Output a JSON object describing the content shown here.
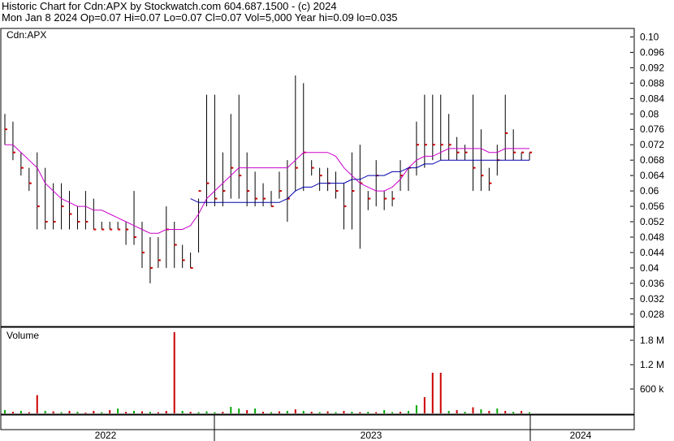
{
  "header": {
    "line1": "Historic Chart for Cdn:APX by Stockwatch.com 604.687.1500 - (c) 2024",
    "line2": "Mon Jan  8 2024  Op=0.07  Hi=0.07  Lo=0.07  Cl=0.07  Vol=5,000  Year hi=0.09  lo=0.035"
  },
  "chart_data": [
    {
      "type": "line",
      "title": "Cdn:APX",
      "symbol": "Cdn:APX",
      "ylim": [
        0.025,
        0.102
      ],
      "y_ticks": [
        "0.10",
        "0.096",
        "0.092",
        "0.088",
        "0.084",
        "0.08",
        "0.076",
        "0.072",
        "0.068",
        "0.064",
        "0.06",
        "0.056",
        "0.052",
        "0.048",
        "0.044",
        "0.04",
        "0.036",
        "0.032",
        "0.028"
      ],
      "grid": false,
      "colors": {
        "price_bar": "#000000",
        "close_dot": "#cc0000",
        "ma_short": "#cc00cc",
        "ma_long": "#0000aa"
      },
      "x": [
        0,
        10,
        20,
        30,
        40,
        50,
        60,
        70,
        80,
        90,
        100,
        110,
        120,
        130,
        140,
        150,
        160,
        170,
        180,
        190,
        200,
        210,
        220,
        230,
        240,
        250,
        260,
        270,
        280,
        290,
        300,
        310,
        320,
        330,
        340,
        350,
        360,
        370,
        380,
        390,
        400,
        410,
        420,
        430,
        440,
        450,
        460,
        470,
        480,
        490,
        500,
        510,
        520,
        530,
        540,
        550,
        560,
        570,
        580,
        590,
        600,
        610,
        620,
        630,
        640,
        650
      ],
      "high": [
        0.08,
        0.078,
        0.07,
        0.066,
        0.07,
        0.066,
        0.062,
        0.062,
        0.06,
        0.056,
        0.06,
        0.058,
        0.052,
        0.052,
        0.052,
        0.052,
        0.06,
        0.052,
        0.048,
        0.048,
        0.056,
        0.052,
        0.046,
        0.044,
        0.044,
        0.085,
        0.085,
        0.07,
        0.08,
        0.085,
        0.07,
        0.065,
        0.062,
        0.06,
        0.065,
        0.068,
        0.09,
        0.088,
        0.068,
        0.066,
        0.066,
        0.065,
        0.062,
        0.07,
        0.072,
        0.06,
        0.068,
        0.06,
        0.06,
        0.068,
        0.066,
        0.078,
        0.085,
        0.085,
        0.085,
        0.08,
        0.074,
        0.072,
        0.085,
        0.076,
        0.066,
        0.072,
        0.085,
        0.076,
        0.07,
        0.07
      ],
      "low": [
        0.072,
        0.068,
        0.064,
        0.06,
        0.05,
        0.05,
        0.05,
        0.05,
        0.05,
        0.05,
        0.05,
        0.05,
        0.05,
        0.05,
        0.05,
        0.046,
        0.046,
        0.04,
        0.036,
        0.04,
        0.04,
        0.04,
        0.04,
        0.04,
        0.058,
        0.056,
        0.056,
        0.056,
        0.058,
        0.058,
        0.056,
        0.056,
        0.056,
        0.056,
        0.058,
        0.052,
        0.06,
        0.06,
        0.064,
        0.06,
        0.06,
        0.058,
        0.05,
        0.05,
        0.045,
        0.055,
        0.056,
        0.055,
        0.056,
        0.06,
        0.06,
        0.064,
        0.066,
        0.068,
        0.068,
        0.068,
        0.068,
        0.068,
        0.06,
        0.06,
        0.06,
        0.064,
        0.068,
        0.068,
        0.068,
        0.068
      ],
      "close": [
        0.076,
        0.07,
        0.066,
        0.062,
        0.056,
        0.052,
        0.052,
        0.056,
        0.054,
        0.052,
        0.052,
        0.05,
        0.05,
        0.05,
        0.05,
        0.05,
        0.048,
        0.044,
        0.04,
        0.042,
        0.05,
        0.046,
        0.042,
        0.04,
        0.06,
        0.062,
        0.058,
        0.06,
        0.066,
        0.064,
        0.06,
        0.058,
        0.058,
        0.056,
        0.06,
        0.058,
        0.066,
        0.07,
        0.066,
        0.064,
        0.062,
        0.06,
        0.056,
        0.06,
        0.062,
        0.058,
        0.064,
        0.058,
        0.058,
        0.064,
        0.066,
        0.072,
        0.072,
        0.072,
        0.072,
        0.072,
        0.07,
        0.07,
        0.066,
        0.064,
        0.062,
        0.068,
        0.075,
        0.07,
        0.07,
        0.07
      ],
      "ma_short": [
        0.072,
        0.072,
        0.07,
        0.068,
        0.066,
        0.062,
        0.06,
        0.058,
        0.057,
        0.056,
        0.056,
        0.055,
        0.055,
        0.054,
        0.053,
        0.052,
        0.051,
        0.05,
        0.049,
        0.049,
        0.05,
        0.05,
        0.05,
        0.051,
        0.054,
        0.058,
        0.06,
        0.062,
        0.064,
        0.066,
        0.066,
        0.066,
        0.066,
        0.066,
        0.066,
        0.066,
        0.068,
        0.07,
        0.07,
        0.07,
        0.07,
        0.069,
        0.066,
        0.064,
        0.062,
        0.061,
        0.06,
        0.06,
        0.061,
        0.063,
        0.066,
        0.068,
        0.069,
        0.069,
        0.07,
        0.071,
        0.071,
        0.071,
        0.071,
        0.071,
        0.07,
        0.07,
        0.071,
        0.071,
        0.071,
        0.071
      ],
      "ma_long": [
        null,
        null,
        null,
        null,
        null,
        null,
        null,
        null,
        null,
        null,
        null,
        null,
        null,
        null,
        null,
        null,
        null,
        null,
        null,
        null,
        null,
        null,
        null,
        0.058,
        0.057,
        0.057,
        0.057,
        0.057,
        0.057,
        0.057,
        0.057,
        0.057,
        0.057,
        0.057,
        0.057,
        0.058,
        0.06,
        0.061,
        0.061,
        0.062,
        0.062,
        0.062,
        0.062,
        0.063,
        0.063,
        0.064,
        0.064,
        0.064,
        0.065,
        0.065,
        0.066,
        0.066,
        0.067,
        0.067,
        0.068,
        0.068,
        0.068,
        0.068,
        0.068,
        0.068,
        0.068,
        0.068,
        0.068,
        0.068,
        0.068,
        0.068
      ]
    },
    {
      "type": "bar",
      "title": "Volume",
      "ylim": [
        0,
        2100000
      ],
      "y_ticks": [
        "1.8 M",
        "1.2 M",
        "600 k"
      ],
      "grid": false,
      "x": [
        0,
        10,
        20,
        30,
        40,
        50,
        60,
        70,
        80,
        90,
        100,
        110,
        120,
        130,
        140,
        150,
        160,
        170,
        180,
        190,
        200,
        210,
        220,
        230,
        240,
        250,
        260,
        270,
        280,
        290,
        300,
        310,
        320,
        330,
        340,
        350,
        360,
        370,
        380,
        390,
        400,
        410,
        420,
        430,
        440,
        450,
        460,
        470,
        480,
        490,
        500,
        510,
        520,
        530,
        540,
        550,
        560,
        570,
        580,
        590,
        600,
        610,
        620,
        630,
        640,
        650
      ],
      "values": [
        80000,
        40000,
        60000,
        30000,
        450000,
        60000,
        50000,
        30000,
        60000,
        40000,
        20000,
        60000,
        30000,
        80000,
        120000,
        40000,
        60000,
        50000,
        40000,
        30000,
        60000,
        2000000,
        60000,
        40000,
        30000,
        50000,
        30000,
        40000,
        160000,
        120000,
        80000,
        120000,
        40000,
        30000,
        50000,
        60000,
        100000,
        60000,
        40000,
        30000,
        50000,
        30000,
        60000,
        40000,
        30000,
        40000,
        30000,
        80000,
        30000,
        40000,
        60000,
        200000,
        400000,
        1000000,
        1000000,
        60000,
        80000,
        40000,
        150000,
        100000,
        60000,
        120000,
        60000,
        40000,
        60000,
        30000
      ],
      "up": [
        true,
        false,
        true,
        false,
        false,
        true,
        false,
        true,
        false,
        true,
        false,
        false,
        true,
        false,
        true,
        false,
        true,
        false,
        true,
        false,
        false,
        false,
        true,
        false,
        true,
        true,
        true,
        false,
        true,
        true,
        false,
        true,
        false,
        true,
        false,
        true,
        false,
        true,
        false,
        true,
        false,
        true,
        false,
        true,
        false,
        true,
        false,
        true,
        true,
        false,
        true,
        true,
        false,
        false,
        false,
        true,
        false,
        true,
        false,
        true,
        false,
        true,
        false,
        true,
        false,
        true
      ],
      "colors": {
        "up": "#00aa00",
        "down": "#cc0000",
        "neutral": "#888888"
      }
    }
  ],
  "x_axis": {
    "years": [
      {
        "label": "2022"
      },
      {
        "label": "2023"
      },
      {
        "label": "2024"
      }
    ]
  }
}
